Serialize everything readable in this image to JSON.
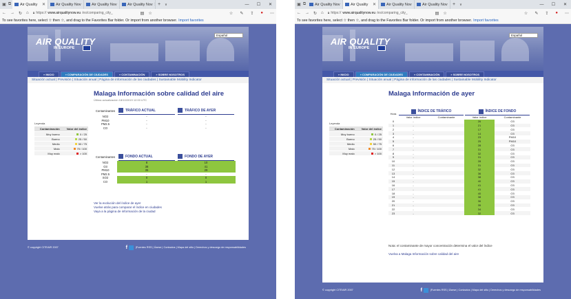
{
  "left": {
    "tabs": [
      {
        "label": "Air Quality",
        "active": true
      },
      {
        "label": "Air Quality Nov",
        "active": false
      },
      {
        "label": "Air Quality Nov",
        "active": false
      },
      {
        "label": "Air Quality Nov",
        "active": false
      }
    ],
    "url_prefix": "https://",
    "url_host": "www.airqualitynow.eu",
    "url_path": "/es/comparing_city_"
  },
  "right": {
    "tabs": [
      {
        "label": "Air Quality Nov",
        "active": false
      },
      {
        "label": "Air Quality",
        "active": true
      },
      {
        "label": "Air Quality Nov",
        "active": false
      },
      {
        "label": "Air Quality Nov",
        "active": false
      }
    ],
    "url_prefix": "https://",
    "url_host": "www.airqualitynow.eu",
    "url_path": "/es/comparing_city_"
  },
  "favorites_bar": {
    "text": "To see favorites here, select ☆ then ☆, and drag to the Favorites Bar folder. Or import from another browser.",
    "link": "Import favorites"
  },
  "site": {
    "logo": "AIR QUALITY",
    "logo_sub": "IN EUROPE",
    "lang": "Español",
    "nav": [
      "» INICIO",
      "» COMPARACIÓN DE CIUDADES",
      "» CONTAMINACIÓN",
      "» SOBRE NOSOTROS"
    ],
    "subnav": "Situación actual  |  Previsión  |  Situación anual  |  Página de información de las ciudades  |  Sustainable Mobility Indicator",
    "footer_left": "© copyright CITEAIR 2007",
    "footer_right": "|Fuentes RSS | Úsese | Contactos | Mapa del sitio | Derechos y descargo de responsabilidades"
  },
  "page1": {
    "title": "Malaga Información sobre calidad del aire",
    "updated": "Última actualización 18/10/2019 12:00 UTC",
    "legend_title": "Leyenda",
    "legend_headers": [
      "Contaminación",
      "Valor del índice"
    ],
    "legend": [
      {
        "label": "Muy bueno",
        "value": "0 / 25",
        "color": "#8ec63f"
      },
      {
        "label": "Bueno",
        "value": "25 / 50",
        "color": "#b5d84a"
      },
      {
        "label": "Medio",
        "value": "50 / 75",
        "color": "#f2d23c"
      },
      {
        "label": "Malo",
        "value": "75 / 100",
        "color": "#f28c28"
      },
      {
        "label": "Muy malo",
        "value": "> 100",
        "color": "#e02020"
      }
    ],
    "traffic_label": "Contaminantes",
    "traffic_now": "TRÁFICO ACTUAL",
    "traffic_yesterday": "TRÁFICO DE AYER",
    "traffic_rows": [
      {
        "p": "NO2",
        "a": "-",
        "b": "-"
      },
      {
        "p": "PM10",
        "a": "-",
        "b": "-"
      },
      {
        "p": "PM2.5",
        "a": "-",
        "b": "-"
      },
      {
        "p": "CO",
        "a": "-",
        "b": "-"
      }
    ],
    "bg_label": "Contaminantes",
    "bg_now": "FONDO ACTUAL",
    "bg_yesterday": "FONDO DE AYER",
    "bg_rows": [
      {
        "p": "NO2",
        "a": "8",
        "b": "10"
      },
      {
        "p": "O3",
        "a": "38",
        "b": "41"
      },
      {
        "p": "PM10",
        "a": "35",
        "b": "29"
      },
      {
        "p": "PM2.5",
        "a": "-",
        "b": "-"
      },
      {
        "p": "SO2",
        "a": "0",
        "b": "0"
      },
      {
        "p": "CO",
        "a": "1",
        "b": "1"
      }
    ],
    "links": [
      "Ver la evolución del índice de ayer",
      "Vuelve atrás para comparar el índice en ciudades",
      "Vaya a la página de información de la ciudad"
    ]
  },
  "page2": {
    "title": "Malaga Información de ayer",
    "legend_title": "Leyenda",
    "legend_headers": [
      "Contaminación",
      "Valor del índice"
    ],
    "legend": [
      {
        "label": "Muy bueno",
        "value": "0 / 25",
        "color": "#8ec63f"
      },
      {
        "label": "Bueno",
        "value": "25 / 50",
        "color": "#b5d84a"
      },
      {
        "label": "Medio",
        "value": "50 / 75",
        "color": "#f2d23c"
      },
      {
        "label": "Malo",
        "value": "75 / 100",
        "color": "#f28c28"
      },
      {
        "label": "Muy malo",
        "value": "> 100",
        "color": "#e02020"
      }
    ],
    "hour_header": "Hora",
    "traffic_title": "ÍNDICE DE TRÁFICO",
    "bg_title": "ÍNDICE DE FONDO",
    "col_value": "Valor índice",
    "col_pollutant": "Contaminante",
    "rows": [
      {
        "h": "0",
        "tv": "-",
        "tp": "",
        "bv": "26",
        "bp": "O3"
      },
      {
        "h": "1",
        "tv": "-",
        "tp": "",
        "bv": "21",
        "bp": "O3"
      },
      {
        "h": "2",
        "tv": "-",
        "tp": "",
        "bv": "17",
        "bp": "O3"
      },
      {
        "h": "3",
        "tv": "-",
        "tp": "",
        "bv": "14",
        "bp": "O3"
      },
      {
        "h": "4",
        "tv": "-",
        "tp": "",
        "bv": "23",
        "bp": "PM10"
      },
      {
        "h": "5",
        "tv": "-",
        "tp": "",
        "bv": "25",
        "bp": "PM10"
      },
      {
        "h": "6",
        "tv": "-",
        "tp": "",
        "bv": "28",
        "bp": "O3"
      },
      {
        "h": "7",
        "tv": "-",
        "tp": "",
        "bv": "31",
        "bp": "O3"
      },
      {
        "h": "8",
        "tv": "-",
        "tp": "",
        "bv": "32",
        "bp": "O3"
      },
      {
        "h": "9",
        "tv": "-",
        "tp": "",
        "bv": "31",
        "bp": "O3"
      },
      {
        "h": "10",
        "tv": "-",
        "tp": "",
        "bv": "28",
        "bp": "O3"
      },
      {
        "h": "11",
        "tv": "-",
        "tp": "",
        "bv": "31",
        "bp": "O3"
      },
      {
        "h": "12",
        "tv": "-",
        "tp": "",
        "bv": "32",
        "bp": "O3"
      },
      {
        "h": "13",
        "tv": "-",
        "tp": "",
        "bv": "36",
        "bp": "O3"
      },
      {
        "h": "14",
        "tv": "-",
        "tp": "",
        "bv": "38",
        "bp": "O3"
      },
      {
        "h": "15",
        "tv": "-",
        "tp": "",
        "bv": "40",
        "bp": "O3"
      },
      {
        "h": "16",
        "tv": "-",
        "tp": "",
        "bv": "41",
        "bp": "O3"
      },
      {
        "h": "17",
        "tv": "-",
        "tp": "",
        "bv": "41",
        "bp": "O3"
      },
      {
        "h": "18",
        "tv": "-",
        "tp": "",
        "bv": "40",
        "bp": "O3"
      },
      {
        "h": "19",
        "tv": "-",
        "tp": "",
        "bv": "38",
        "bp": "O3"
      },
      {
        "h": "20",
        "tv": "-",
        "tp": "",
        "bv": "36",
        "bp": "O3"
      },
      {
        "h": "21",
        "tv": "-",
        "tp": "",
        "bv": "35",
        "bp": "O3"
      },
      {
        "h": "22",
        "tv": "-",
        "tp": "",
        "bv": "34",
        "bp": "O3"
      },
      {
        "h": "23",
        "tv": "-",
        "tp": "",
        "bv": "32",
        "bp": "O3"
      }
    ],
    "note": "Nota: el contaminante de mayor concentración determina el valor del índice",
    "back_link": "Vuelva a Malaga Información sobre calidad del aire"
  },
  "colors": {
    "page_bg": "#5d6caf",
    "good": "#8ec63f",
    "title": "#2c3b8f"
  }
}
